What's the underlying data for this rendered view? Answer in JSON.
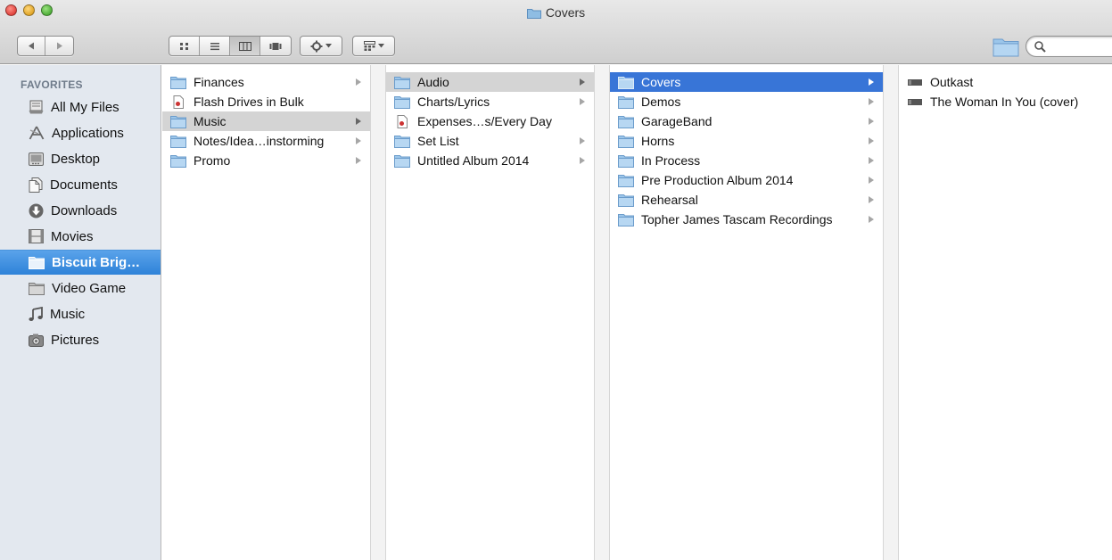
{
  "window": {
    "title": "Covers",
    "search_placeholder": ""
  },
  "colors": {
    "selection_blue": "#3875d7",
    "sidebar_selected": "#2e82d8",
    "sidebar_bg": "#e3e8ef",
    "path_highlight": "#d4d4d4",
    "folder_blue": "#7fb0d9"
  },
  "sidebar": {
    "heading": "FAVORITES",
    "items": [
      {
        "label": "All My Files",
        "icon": "all-files-icon"
      },
      {
        "label": "Applications",
        "icon": "applications-icon"
      },
      {
        "label": "Desktop",
        "icon": "desktop-icon"
      },
      {
        "label": "Documents",
        "icon": "documents-icon"
      },
      {
        "label": "Downloads",
        "icon": "downloads-icon"
      },
      {
        "label": "Movies",
        "icon": "movies-icon"
      },
      {
        "label": "Biscuit Brig…",
        "icon": "folder-icon",
        "selected": true
      },
      {
        "label": "Video Game",
        "icon": "folder-icon"
      },
      {
        "label": "Music",
        "icon": "music-note-icon"
      },
      {
        "label": "Pictures",
        "icon": "camera-icon"
      }
    ]
  },
  "columns": [
    {
      "items": [
        {
          "label": "Finances",
          "icon": "folder-icon",
          "has_children": true
        },
        {
          "label": "Flash Drives in Bulk",
          "icon": "document-icon",
          "has_children": false
        },
        {
          "label": "Music",
          "icon": "folder-icon",
          "has_children": true,
          "state": "path"
        },
        {
          "label": "Notes/Idea…instorming",
          "icon": "folder-icon",
          "has_children": true
        },
        {
          "label": "Promo",
          "icon": "folder-icon",
          "has_children": true
        }
      ]
    },
    {
      "items": [
        {
          "label": "Audio",
          "icon": "folder-icon",
          "has_children": true,
          "state": "path"
        },
        {
          "label": "Charts/Lyrics",
          "icon": "folder-icon",
          "has_children": true
        },
        {
          "label": "Expenses…s/Every Day",
          "icon": "document-icon",
          "has_children": false
        },
        {
          "label": "Set List",
          "icon": "folder-icon",
          "has_children": true
        },
        {
          "label": "Untitled Album 2014",
          "icon": "folder-icon",
          "has_children": true
        }
      ]
    },
    {
      "items": [
        {
          "label": "Covers",
          "icon": "folder-icon",
          "has_children": true,
          "state": "selected"
        },
        {
          "label": "Demos",
          "icon": "folder-icon",
          "has_children": true
        },
        {
          "label": "GarageBand",
          "icon": "folder-icon",
          "has_children": true
        },
        {
          "label": "Horns",
          "icon": "folder-icon",
          "has_children": true
        },
        {
          "label": "In Process",
          "icon": "folder-icon",
          "has_children": true
        },
        {
          "label": "Pre Production Album 2014",
          "icon": "folder-icon",
          "has_children": true
        },
        {
          "label": "Rehearsal",
          "icon": "folder-icon",
          "has_children": true
        },
        {
          "label": "Topher James Tascam Recordings",
          "icon": "folder-icon",
          "has_children": true
        }
      ]
    },
    {
      "items": [
        {
          "label": "Outkast",
          "icon": "video-file-icon",
          "has_children": false
        },
        {
          "label": "The Woman In You (cover)",
          "icon": "video-file-icon",
          "has_children": false
        }
      ]
    }
  ]
}
